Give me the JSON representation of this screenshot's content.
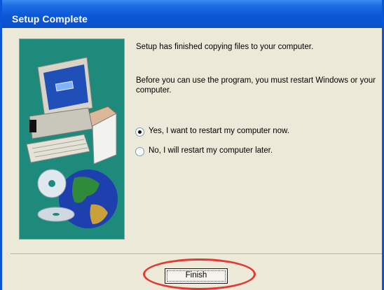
{
  "dialog": {
    "title": "Setup Complete",
    "message_1": "Setup has finished copying files to your computer.",
    "message_2": "Before you can use the program, you must restart Windows or your computer.",
    "options": [
      {
        "label": "Yes, I want to restart my computer now.",
        "selected": true
      },
      {
        "label": "No, I will restart my computer later.",
        "selected": false
      }
    ],
    "finish_label": "Finish"
  },
  "colors": {
    "titlebar": "#0a56d8",
    "art_background": "#1e8a7c",
    "highlight": "#e23a33",
    "window_body": "#ece9d8"
  },
  "icons": [
    "computer-illustration",
    "cd-icon",
    "globe-icon"
  ]
}
